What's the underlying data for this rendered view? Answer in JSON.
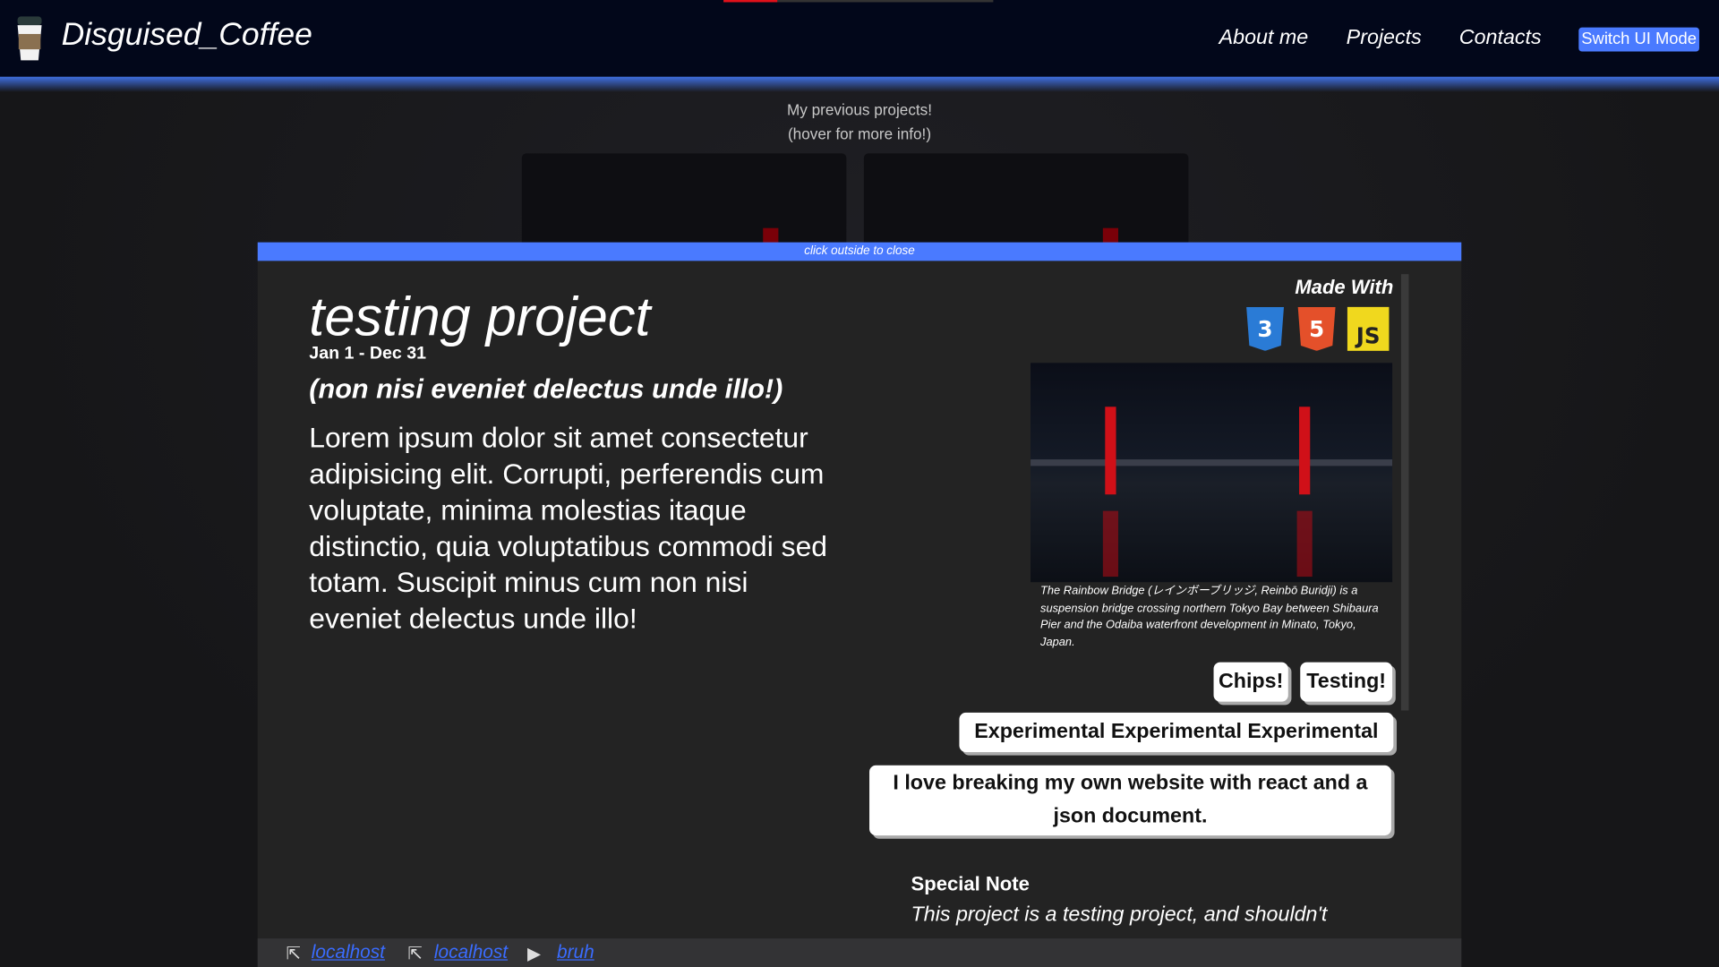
{
  "nav": {
    "brand": "Disguised_Coffee",
    "links": [
      "About me",
      "Projects",
      "Contacts"
    ],
    "switch_label": "Switch UI Mode",
    "loading_progress": 0.2
  },
  "projects": {
    "heading": "My previous projects!",
    "hint": "(hover for more info!)"
  },
  "modal": {
    "close_hint": "click outside to close",
    "title": "testing project",
    "date": "Jan 1 - Dec 31",
    "subtitle": "(non nisi eveniet delectus unde illo!)",
    "description": "Lorem ipsum dolor sit amet consectetur adipisicing elit. Corrupti, perferendis cum voluptate, minima molestias itaque distinctio, quia voluptatibus commodi sed totam. Suscipit minus cum non nisi eveniet delectus unde illo!",
    "made_with": "Made With",
    "tech": [
      {
        "name": "css3-icon",
        "label": "3",
        "color": "#2a7bd6"
      },
      {
        "name": "html5-icon",
        "label": "5",
        "color": "#e4502a"
      },
      {
        "name": "javascript-icon",
        "label": "JS",
        "color": "#f0d81e"
      }
    ],
    "image_caption": "The Rainbow Bridge (レインボーブリッジ, Reinbō Buridji) is a suspension bridge crossing northern Tokyo Bay between Shibaura Pier and the Odaiba waterfront development in Minato, Tokyo, Japan.",
    "chips": [
      "Chips!",
      "Testing!",
      "Experimental Experimental Experimental",
      "I love breaking my own website with react and a json document."
    ],
    "special_note_heading": "Special Note",
    "special_note": "This project is a testing project, and shouldn't"
  },
  "footer": {
    "links": [
      {
        "icon": "external-link-icon",
        "label": "localhost"
      },
      {
        "icon": "external-link-icon",
        "label": "localhost"
      },
      {
        "icon": "video-icon",
        "label": "bruh"
      }
    ]
  },
  "colors": {
    "accent": "#4a7aff",
    "nav_bg": "#02071a",
    "modal_bg": "#232323"
  }
}
